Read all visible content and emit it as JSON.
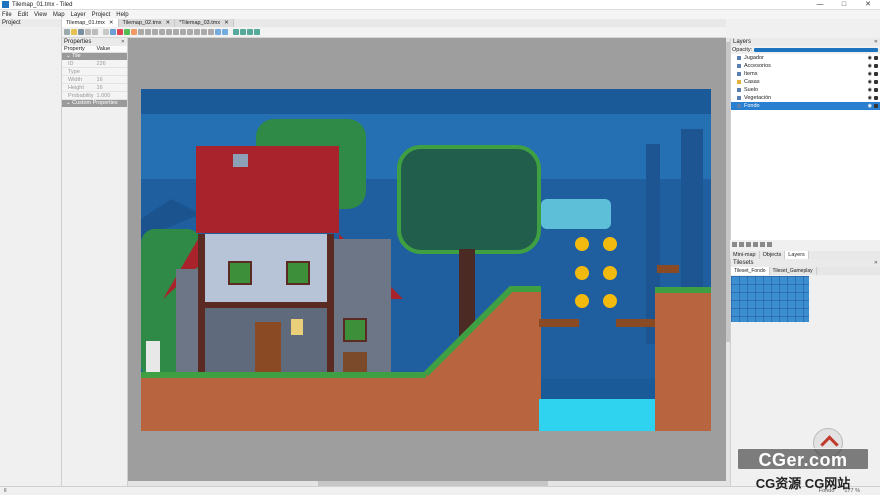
{
  "window": {
    "title": "Tilemap_01.tmx - Tiled",
    "minimize": "—",
    "maximize": "□",
    "close": "✕"
  },
  "menu": [
    "File",
    "Edit",
    "View",
    "Map",
    "Layer",
    "Project",
    "Help"
  ],
  "project_panel": {
    "title": "Project"
  },
  "doc_tabs": [
    {
      "label": "Tilemap_01.tmx",
      "active": true
    },
    {
      "label": "Tilemap_02.tmx",
      "active": false
    },
    {
      "label": "*Tilemap_03.tmx",
      "active": false
    }
  ],
  "properties": {
    "title": "Properties",
    "col_property": "Property",
    "col_value": "Value",
    "group_tile": "Tile",
    "rows": [
      {
        "name": "ID",
        "value": "226"
      },
      {
        "name": "Type",
        "value": ""
      },
      {
        "name": "Width",
        "value": "16"
      },
      {
        "name": "Height",
        "value": "16"
      },
      {
        "name": "Probability",
        "value": "1.000"
      }
    ],
    "group_custom": "Custom Properties"
  },
  "layers": {
    "title": "Layers",
    "opacity_label": "Opacity:",
    "items": [
      {
        "name": "Jugador",
        "kind": "layer",
        "selected": false
      },
      {
        "name": "Accesorios",
        "kind": "layer",
        "selected": false
      },
      {
        "name": "Items",
        "kind": "layer",
        "selected": false
      },
      {
        "name": "Casas",
        "kind": "group",
        "selected": false
      },
      {
        "name": "Suelo",
        "kind": "layer",
        "selected": false
      },
      {
        "name": "Vegetación",
        "kind": "layer",
        "selected": false
      },
      {
        "name": "Fondo",
        "kind": "layer",
        "selected": true
      }
    ]
  },
  "bottom_tabs": [
    "Mini-map",
    "Objects",
    "Layers"
  ],
  "tilesets": {
    "title": "Tilesets",
    "tabs": [
      "Tileset_Fondo",
      "Tileset_Gameplay"
    ]
  },
  "status": {
    "left": "Ⅱ",
    "zoom": "177 %",
    "right": "Fondo"
  },
  "watermark": {
    "main": "CGer.com",
    "sub": "CG资源 CG网站"
  },
  "colors": {
    "accent": "#1e73be",
    "sky_dark": "#1a5a98",
    "grass": "#3ea043",
    "dirt": "#b8643e",
    "roof": "#a8232b",
    "coin": "#f2b90f",
    "water": "#2fd3f0"
  }
}
